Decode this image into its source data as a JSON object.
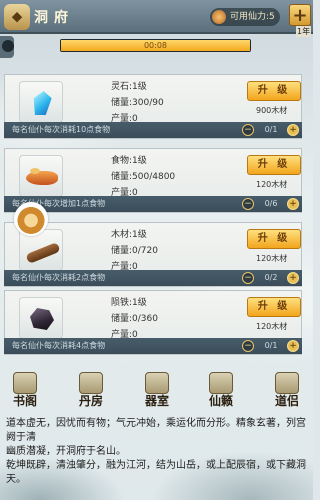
{
  "header": {
    "title": "洞府",
    "title_icon": "洞府-badge",
    "spirit_label": "可用仙力:5",
    "plus_label": "+",
    "year_label": "1年"
  },
  "progress": {
    "text": "00:08",
    "fraction": 1.0
  },
  "resources": [
    {
      "icon": "spirit-stone-icon",
      "name": "灵石:1级",
      "storage": "储量:300/90",
      "output": "产量:0",
      "upgrade_label": "升 级",
      "cost": "900木材",
      "strip_text": "每名仙仆每次消耗10点食物",
      "qty": "0/1"
    },
    {
      "icon": "food-icon",
      "name": "食物:1级",
      "storage": "储量:500/4800",
      "output": "产量:0",
      "upgrade_label": "升 级",
      "cost": "120木材",
      "strip_text": "每名仙仆每次增加1点食物",
      "qty": "0/6"
    },
    {
      "icon": "wood-icon",
      "name": "木材:1级",
      "storage": "储量:0/720",
      "output": "产量:0",
      "upgrade_label": "升 级",
      "cost": "120木材",
      "strip_text": "每名仙仆每次消耗2点食物",
      "qty": "0/2"
    },
    {
      "icon": "iron-icon",
      "name": "陨铁:1级",
      "storage": "储量:0/360",
      "output": "产量:0",
      "upgrade_label": "升 级",
      "cost": "120木材",
      "strip_text": "每名仙仆每次消耗4点食物",
      "qty": "0/1"
    }
  ],
  "nav": [
    {
      "label": "书阁",
      "icon": "book-pavilion-icon"
    },
    {
      "label": "丹房",
      "icon": "alchemy-room-icon"
    },
    {
      "label": "器室",
      "icon": "artifact-room-icon"
    },
    {
      "label": "仙籁",
      "icon": "immortal-music-icon"
    },
    {
      "label": "道侣",
      "icon": "dao-companion-icon"
    }
  ],
  "description": [
    "道本虚无，因忧而有物；气元冲始，乘运化而分形。精象玄著，列宫阙于清",
    "幽质潜凝，开洞府于名山。",
    "乾坤既辟，清浊肇分，融为江河，结为山岳，或上配辰宿，或下藏洞天。"
  ]
}
